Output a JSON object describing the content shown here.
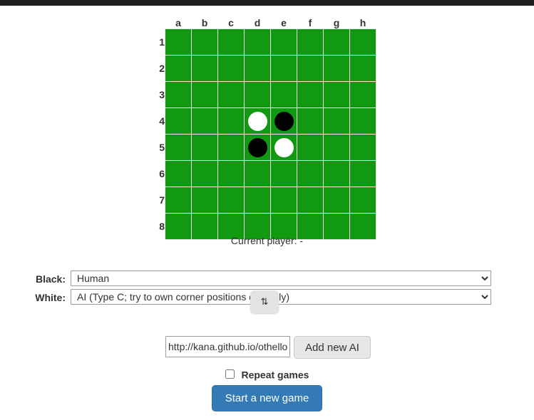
{
  "theme": {
    "board_green": "#119911",
    "grid_line": "#e8e8e8",
    "primary_button": "#337ab7",
    "top_bar": "#1e1e1e"
  },
  "board": {
    "columns": [
      "a",
      "b",
      "c",
      "d",
      "e",
      "f",
      "g",
      "h"
    ],
    "rows": [
      "1",
      "2",
      "3",
      "4",
      "5",
      "6",
      "7",
      "8"
    ],
    "cells": [
      [
        "",
        "",
        "",
        "",
        "",
        "",
        "",
        ""
      ],
      [
        "",
        "",
        "",
        "",
        "",
        "",
        "",
        ""
      ],
      [
        "",
        "",
        "",
        "",
        "",
        "",
        "",
        ""
      ],
      [
        "",
        "",
        "",
        "white",
        "black",
        "",
        "",
        ""
      ],
      [
        "",
        "",
        "",
        "black",
        "white",
        "",
        "",
        ""
      ],
      [
        "",
        "",
        "",
        "",
        "",
        "",
        "",
        ""
      ],
      [
        "",
        "",
        "",
        "",
        "",
        "",
        "",
        ""
      ],
      [
        "",
        "",
        "",
        "",
        "",
        "",
        "",
        ""
      ]
    ]
  },
  "status": {
    "current_player": "Current player: -"
  },
  "players": {
    "black": {
      "label": "Black:",
      "selected": "Human"
    },
    "white": {
      "label": "White:",
      "selected": "AI (Type C; try to own corner positions carefully)"
    }
  },
  "drag_badge": {
    "glyph": "⇅"
  },
  "add_ai": {
    "url_value": "http://kana.github.io/othello-",
    "button_label": "Add new AI"
  },
  "repeat": {
    "label": "Repeat games",
    "checked": false
  },
  "start": {
    "label": "Start a new game"
  }
}
